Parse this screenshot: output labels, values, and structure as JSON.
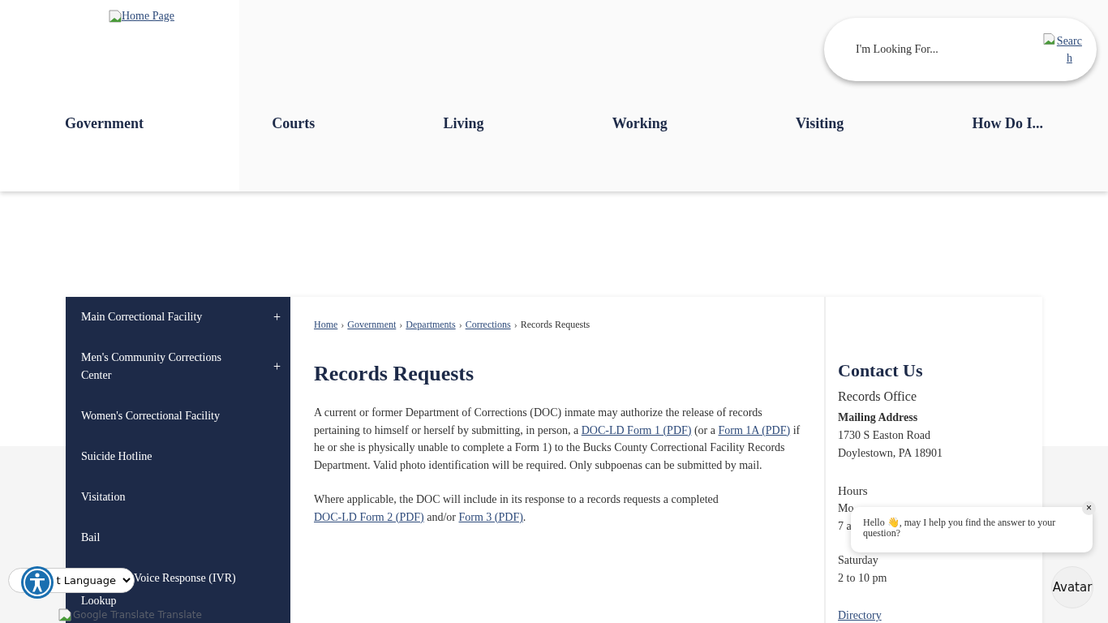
{
  "header": {
    "logo_link": "Home Page",
    "search": {
      "placeholder": "I'm Looking For...",
      "button": "Search"
    }
  },
  "nav": [
    "Government",
    "Courts",
    "Living",
    "Working",
    "Visiting",
    "How Do I..."
  ],
  "sidebar": {
    "items": [
      {
        "label": "Main Correctional Facility",
        "toggle": "+"
      },
      {
        "label": "Men's Community Corrections Center",
        "toggle": "+"
      },
      {
        "label": "Women's Correctional Facility"
      },
      {
        "label": "Suicide Hotline"
      },
      {
        "label": "Visitation"
      },
      {
        "label": "Bail"
      },
      {
        "label": "Voice Response (IVR)",
        "continuation": "Lookup"
      }
    ]
  },
  "breadcrumb_separator": "›",
  "breadcrumb": [
    {
      "label": "Home",
      "link": true
    },
    {
      "label": "Government",
      "link": true
    },
    {
      "label": "Departments",
      "link": true
    },
    {
      "label": "Corrections",
      "link": true
    },
    {
      "label": "Records Requests",
      "link": false
    }
  ],
  "title": "Records Requests",
  "paragraphs": [
    [
      {
        "kind": "text",
        "text": "A current or former Department of Corrections (DOC) inmate may authorize the release of records pertaining to himself or herself by submitting, in person, a "
      },
      {
        "kind": "link",
        "text": "DOC-LD Form 1 (PDF)"
      },
      {
        "kind": "text",
        "text": " (or a "
      },
      {
        "kind": "link",
        "text": "Form 1A (PDF)"
      },
      {
        "kind": "text",
        "text": " if he or she is physically unable to complete a Form 1) to the Bucks County Correctional Facility Records Department. Valid photo identification will be required. Only subpoenas can be submitted by mail."
      }
    ],
    [
      {
        "kind": "text",
        "text": "Where applicable, the DOC will include in its response to a records requests a completed "
      },
      {
        "kind": "link",
        "text": "DOC-LD Form 2 (PDF)"
      },
      {
        "kind": "text",
        "text": " and/or "
      },
      {
        "kind": "link",
        "text": "Form 3 (PDF)"
      },
      {
        "kind": "text",
        "text": "."
      }
    ]
  ],
  "contact": {
    "title": "Contact Us",
    "office": "Records Office",
    "mailing_label": "Mailing Address",
    "address": [
      "1730 S Easton Road",
      "Doylestown, PA 18901"
    ],
    "hours_label": "Hours",
    "hours": [
      "Mo",
      "7 a"
    ],
    "saturday_label": "Saturday",
    "saturday_hours": "2 to 10 pm",
    "directory_link": "Directory"
  },
  "language_widget": {
    "select": "t Language",
    "translate_text": "Google Translate Translate"
  },
  "chat": {
    "message_before": "Hello ",
    "emoji": "👋",
    "message_after": ", may I help you find the answer to your question?",
    "close": "×",
    "avatar": "Avatar"
  }
}
